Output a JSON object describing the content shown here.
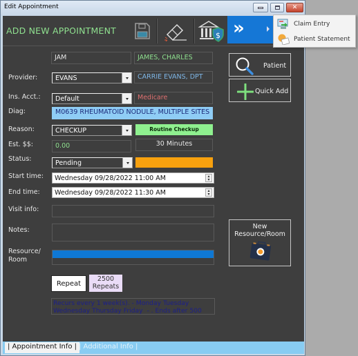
{
  "window": {
    "title": "Edit Appointment",
    "controls": {
      "minimize": "minimize",
      "maximize": "maximize",
      "close": "close"
    }
  },
  "header": {
    "title": "ADD NEW APPOINTMENT",
    "toolbar": [
      {
        "name": "save",
        "icon": "floppy-disk-icon"
      },
      {
        "name": "clear",
        "icon": "eraser-icon"
      },
      {
        "name": "billing",
        "icon": "bank-shield-dollar-icon"
      },
      {
        "name": "more",
        "icon": "double-chevron-right-icon"
      }
    ],
    "more_glyph": "»"
  },
  "popup_menu": {
    "items": [
      {
        "label": "Claim Entry",
        "icon": "claim-entry-icon"
      },
      {
        "label": "Patient Statement",
        "icon": "patient-statement-icon"
      }
    ]
  },
  "form": {
    "patient_code": "JAM",
    "patient_name": "JAMES, CHARLES",
    "provider": {
      "label": "Provider:",
      "value": "EVANS",
      "display": "CARRIE EVANS, DPT"
    },
    "ins_acct": {
      "label": "Ins. Acct.:",
      "value": "Default",
      "display": "Medicare"
    },
    "diag": {
      "label": "Diag:",
      "value": "M0639 RHEUMATOID NODULE, MULTIPLE SITES"
    },
    "reason": {
      "label": "Reason:",
      "value": "CHECKUP",
      "display": "Routine Checkup"
    },
    "est": {
      "label": "Est. $$:",
      "value": "0.00",
      "duration": "30 Minutes"
    },
    "status": {
      "label": "Status:",
      "value": "Pending",
      "color": "#f8a10e"
    },
    "start_time": {
      "label": "Start time:",
      "value": "Wednesday 09/28/2022 11:00 AM"
    },
    "end_time": {
      "label": "End time:",
      "value": "Wednesday 09/28/2022 11:30 AM"
    },
    "visit_info": {
      "label": "Visit info:",
      "value": ""
    },
    "notes": {
      "label": "Notes:",
      "value": ""
    },
    "resource": {
      "label_line1": "Resource/",
      "label_line2": "Room",
      "selected_color": "#0f78d4"
    }
  },
  "side_buttons": {
    "patient": "Patient",
    "quick_add": "Quick Add",
    "new_resource_line1": "New",
    "new_resource_line2": "Resource/Room"
  },
  "repeat": {
    "button": "Repeat",
    "count": "2500",
    "count_label": "Repeats",
    "summary_line1": "Recurs every 1 week(s). - Monday Tuesday",
    "summary_line2": "Wednesday Thursday Friday  - . Ends after 500"
  },
  "tabs": [
    {
      "label": "| Appointment Info |",
      "active": true
    },
    {
      "label": "| Additional Info |",
      "active": false
    }
  ],
  "colors": {
    "accent_blue": "#1577d6",
    "header_green": "#8fe08f",
    "diag_bg": "#8fcdf5",
    "reason_bg": "#8ff08f",
    "medicare_red": "#e07070",
    "provider_blue": "#7eb6e6"
  }
}
